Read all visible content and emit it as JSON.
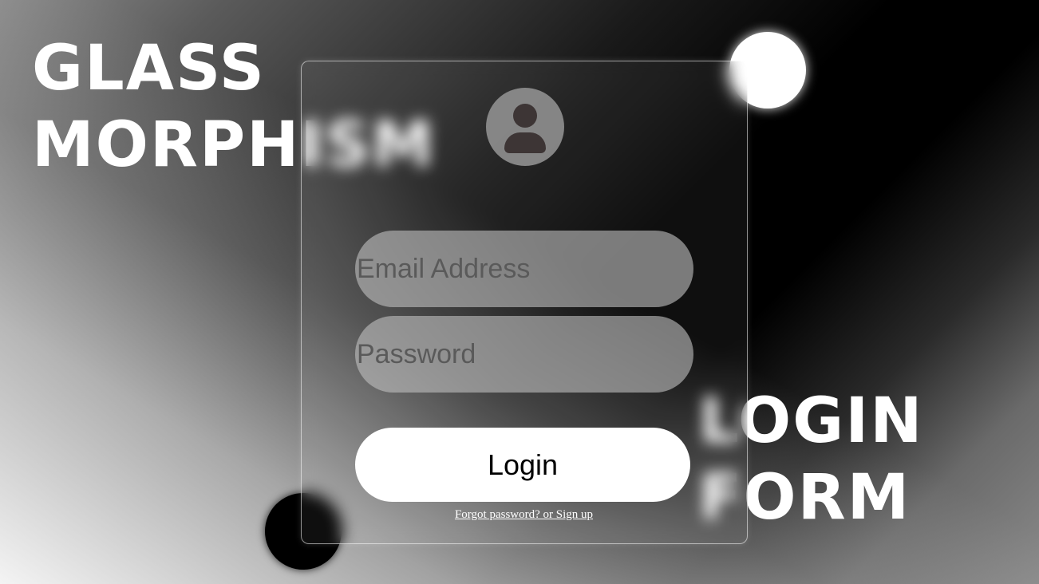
{
  "headline_left": {
    "line1": "GLASS",
    "line2": "MORPHISM"
  },
  "headline_right": {
    "line1": "LOGIN",
    "line2": "FORM"
  },
  "form": {
    "avatar_icon": "user-icon",
    "email_placeholder": "Email Address",
    "password_placeholder": "Password",
    "login_label": "Login",
    "forgot_link": "Forgot password? or Sign up"
  },
  "colors": {
    "card_border": "#ffffff",
    "button_bg": "#ffffff",
    "avatar_figure": "#3d3535",
    "placeholder_text": "#5a5a5a"
  }
}
